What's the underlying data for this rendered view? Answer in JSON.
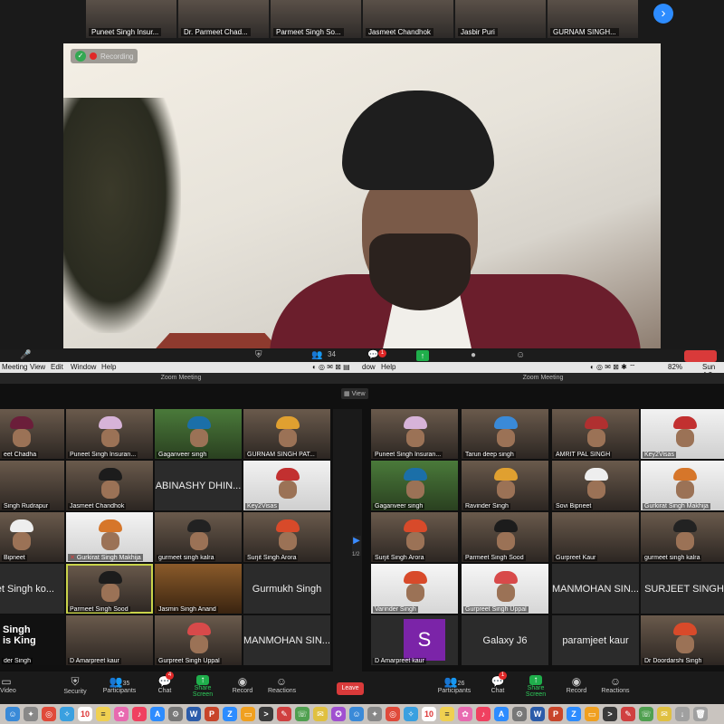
{
  "top_strip": {
    "tiles": [
      {
        "name": "Puneet Singh Insur..."
      },
      {
        "name": "Dr. Parmeet Chad..."
      },
      {
        "name": "Parmeet Singh So..."
      },
      {
        "name": "Jasmeet Chandhok"
      },
      {
        "name": "Jasbir Puri"
      },
      {
        "name": "GURNAM SINGH..."
      }
    ],
    "next_icon": "›"
  },
  "speaker": {
    "recording_label": "Recording",
    "shield_icon": "✓"
  },
  "mid_toolbar": {
    "participants_count": "34",
    "chat_badge": "1",
    "share_icon": "↑"
  },
  "menubar": {
    "left_items": [
      "Meeting",
      "View",
      "Edit",
      "Window",
      "Help"
    ],
    "right_fragment": "dow",
    "right_help": "Help",
    "battery": "82%",
    "clock": "Sun 4:2"
  },
  "windows": {
    "left_title": "Zoom Meeting",
    "right_title": "Zoom Meeting",
    "view_label": "View"
  },
  "left_grid": {
    "rows": [
      [
        {
          "name": "eet Chadha",
          "type": "cam",
          "turban": "#6b1e3a"
        },
        {
          "name": "Puneet Singh Insuran...",
          "type": "cam",
          "turban": "#d7b3d8"
        },
        {
          "name": "Gaganveer singh",
          "type": "cam",
          "turban": "#1b6fa8"
        },
        {
          "name": "GURNAM SINGH PAT...",
          "type": "cam",
          "turban": "#e0a030"
        }
      ],
      [
        {
          "name": "Singh Rudrapur",
          "type": "cam",
          "turban": ""
        },
        {
          "name": "Jasmeet Chandhok",
          "type": "cam",
          "turban": "#1c1c1c"
        },
        {
          "name": "ABINASHY DHIN...",
          "type": "name"
        },
        {
          "name": "Key2Visas",
          "type": "cam",
          "turban": "#c23030"
        }
      ],
      [
        {
          "name": "Bipneet",
          "type": "cam",
          "turban": "#eeeeee"
        },
        {
          "name": "Gurkirat Singh Makhija",
          "type": "cam",
          "turban": "#d6762a"
        },
        {
          "name": "gurmeet singh kalra",
          "type": "cam",
          "turban": "#222222"
        },
        {
          "name": "Surjit Singh Arora",
          "type": "cam",
          "turban": "#d84a2a"
        }
      ],
      [
        {
          "name": "reet Singh ko...",
          "type": "name"
        },
        {
          "name": "Parmeet Singh Sood",
          "type": "cam",
          "turban": "#1c1c1c",
          "active": true
        },
        {
          "name": "Jasmin Singh Anand",
          "type": "cam",
          "turban": ""
        },
        {
          "name": "Gurmukh Singh",
          "type": "name"
        }
      ],
      [
        {
          "name": "der Singh",
          "type": "cam",
          "turban": ""
        },
        {
          "name": "D Amarpreet kaur",
          "type": "cam",
          "turban": ""
        },
        {
          "name": "Gurpreet Singh Uppal",
          "type": "cam",
          "turban": "#d84a4a"
        },
        {
          "name": "MANMOHAN SIN...",
          "type": "name"
        }
      ]
    ],
    "name_tile_labels": {
      "abinashy": "ABINASHY DHIN...",
      "reet": "reet Singh ko...",
      "gurmukh": "Gurmukh Singh",
      "manmohan": "MANMOHAN SIN..."
    },
    "singh_is_king": "Singh is King"
  },
  "right_grid": {
    "rows": [
      [
        {
          "name": "Puneet Singh Insuran...",
          "type": "cam",
          "turban": "#d7b3d8"
        },
        {
          "name": "Tarun deep singh",
          "type": "cam",
          "turban": "#3a8ad8"
        },
        {
          "name": "AMRIT PAL SINGH",
          "type": "cam",
          "turban": "#b03030"
        },
        {
          "name": "Key2Visas",
          "type": "cam",
          "turban": "#c23030"
        }
      ],
      [
        {
          "name": "Gaganveer singh",
          "type": "cam",
          "turban": "#1b6fa8"
        },
        {
          "name": "Ravinder Singh",
          "type": "cam",
          "turban": "#e0a030"
        },
        {
          "name": "Sovi Bipneet",
          "type": "cam",
          "turban": "#eeeeee"
        },
        {
          "name": "Gurkirat Singh Makhija",
          "type": "cam",
          "turban": "#d6762a"
        }
      ],
      [
        {
          "name": "Surjit Singh Arora",
          "type": "cam",
          "turban": "#d84a2a"
        },
        {
          "name": "Parmeet Singh Sood",
          "type": "cam",
          "turban": "#1c1c1c"
        },
        {
          "name": "Gurpreet Kaur",
          "type": "cam",
          "turban": ""
        },
        {
          "name": "gurmeet singh kalra",
          "type": "cam",
          "turban": "#222222"
        }
      ],
      [
        {
          "name": "Varinder Singh",
          "type": "cam",
          "turban": "#d84a2a"
        },
        {
          "name": "Gurpreet Singh Uppal",
          "type": "cam",
          "turban": "#d84a4a"
        },
        {
          "name": "MANMOHAN SIN...",
          "type": "name"
        },
        {
          "name": "SURJEET SINGH",
          "type": "name"
        }
      ],
      [
        {
          "name": "D Amarpreet kaur",
          "type": "avatar",
          "initial": "S"
        },
        {
          "name": "Galaxy J6",
          "type": "name"
        },
        {
          "name": "paramjeet kaur",
          "type": "name"
        },
        {
          "name": "Dr Doordarshi Singh",
          "type": "cam",
          "turban": "#d84a2a"
        }
      ]
    ],
    "pager_label": "1/2"
  },
  "controls": {
    "left": {
      "video": "Video",
      "security": "Security",
      "participants": "Participants",
      "participants_count": "35",
      "chat": "Chat",
      "chat_badge": "4",
      "share": "Share Screen",
      "record": "Record",
      "reactions": "Reactions"
    },
    "leave": "Leave",
    "right": {
      "participants": "Participants",
      "participants_count": "26",
      "chat": "Chat",
      "chat_badge": "1",
      "share": "Share Screen",
      "record": "Record",
      "reactions": "Reactions"
    }
  },
  "dock": {
    "icons": [
      "finder-icon",
      "launchpad-icon",
      "chrome-icon",
      "safari-icon",
      "calendar-icon",
      "notes-icon",
      "photos-icon",
      "music-icon",
      "appstore-icon",
      "settings-icon",
      "word-icon",
      "powerpoint-icon",
      "zoom-icon"
    ],
    "calendar_day": "10",
    "word_letter": "W",
    "ppt_letter": "P",
    "zoom_letter": "Z"
  }
}
